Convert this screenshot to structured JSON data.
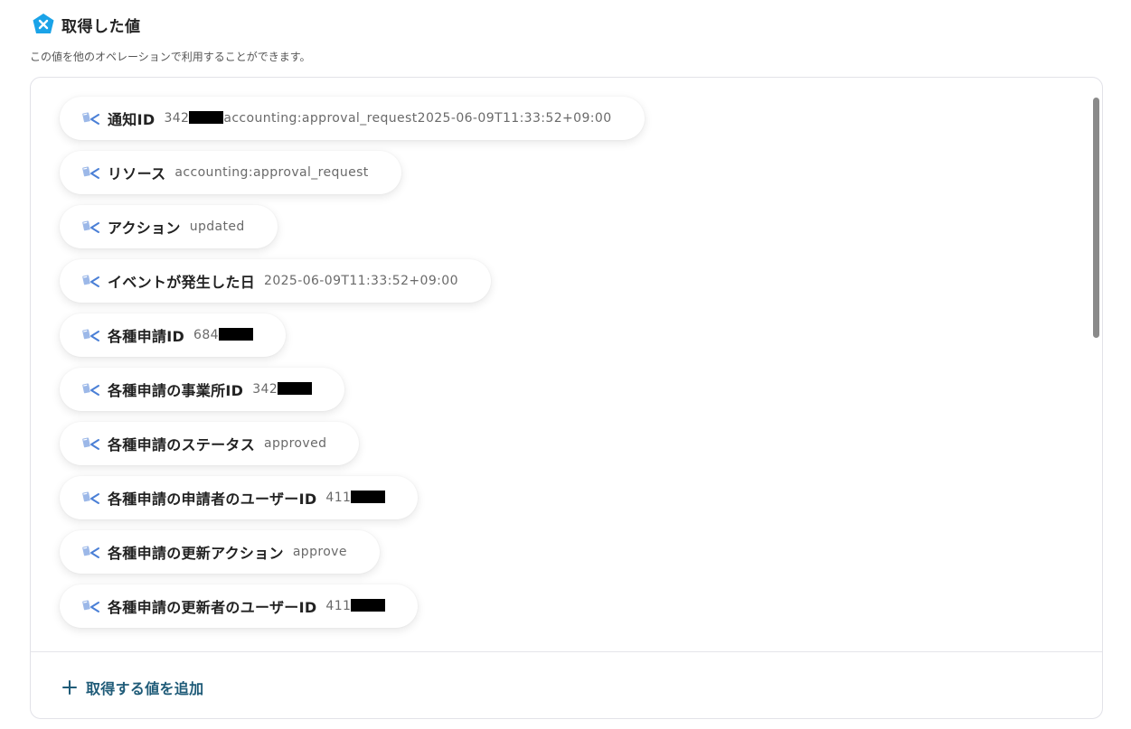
{
  "header": {
    "title": "取得した値",
    "subtitle": "この値を他のオペレーションで利用することができます。",
    "logo_color": "#1aa3e8"
  },
  "items": [
    {
      "label": "通知ID",
      "value_prefix": "342",
      "redacted": true,
      "value_suffix": "accounting:approval_request2025-06-09T11:33:52+09:00"
    },
    {
      "label": "リソース",
      "value_prefix": "accounting:approval_request",
      "redacted": false,
      "value_suffix": ""
    },
    {
      "label": "アクション",
      "value_prefix": "updated",
      "redacted": false,
      "value_suffix": ""
    },
    {
      "label": "イベントが発生した日",
      "value_prefix": "2025-06-09T11:33:52+09:00",
      "redacted": false,
      "value_suffix": ""
    },
    {
      "label": "各種申請ID",
      "value_prefix": "684",
      "redacted": true,
      "value_suffix": ""
    },
    {
      "label": "各種申請の事業所ID",
      "value_prefix": "342",
      "redacted": true,
      "value_suffix": ""
    },
    {
      "label": "各種申請のステータス",
      "value_prefix": "approved",
      "redacted": false,
      "value_suffix": ""
    },
    {
      "label": "各種申請の申請者のユーザーID",
      "value_prefix": "411",
      "redacted": true,
      "value_suffix": ""
    },
    {
      "label": "各種申請の更新アクション",
      "value_prefix": "approve",
      "redacted": false,
      "value_suffix": ""
    },
    {
      "label": "各種申請の更新者のユーザーID",
      "value_prefix": "411",
      "redacted": true,
      "value_suffix": ""
    }
  ],
  "footer": {
    "add_label": "取得する値を追加",
    "accent_color": "#1f5b78"
  },
  "icons": {
    "logo": "freee-logo-icon",
    "item": "value-tag-icon",
    "add": "plus-icon"
  }
}
